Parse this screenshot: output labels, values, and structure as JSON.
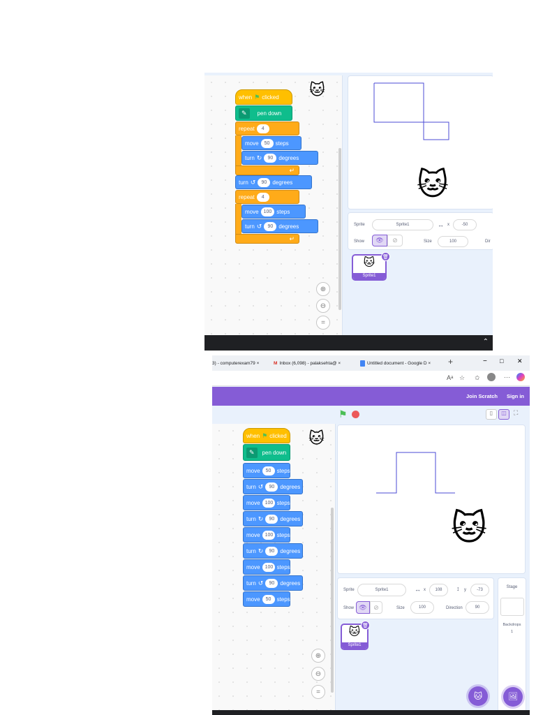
{
  "top": {
    "blocks": {
      "when_clicked": [
        "when",
        "clicked"
      ],
      "pen_down": "pen down",
      "repeat1": {
        "label": "repeat",
        "count": "4"
      },
      "move1": {
        "label": "move",
        "value": "50",
        "unit": "steps"
      },
      "turn_cw": {
        "label": "turn",
        "value": "90",
        "unit": "degrees"
      },
      "turn_ccw": {
        "label": "turn",
        "value": "90",
        "unit": "degrees"
      },
      "repeat2": {
        "label": "repeat",
        "count": "4"
      },
      "move2": {
        "label": "move",
        "value": "100",
        "unit": "steps"
      },
      "turn_ccw2": {
        "label": "turn",
        "value": "90",
        "unit": "degrees"
      }
    },
    "sprite_info": {
      "sprite_label": "Sprite",
      "sprite_name": "Sprite1",
      "x_label": "x",
      "x_value": "-50",
      "show_label": "Show",
      "size_label": "Size",
      "size_value": "100",
      "direction_label_cut": "Dir"
    },
    "sprite_thumb": "Sprite1"
  },
  "bottom": {
    "tabs": [
      {
        "label": "3) - computerexam79 ×"
      },
      {
        "label": "Inbox (6,098) - palaksehta@ ×"
      },
      {
        "label": "Untitled document - Google D ×"
      }
    ],
    "window_controls": [
      "−",
      "□",
      "✕"
    ],
    "header": {
      "join": "Join Scratch",
      "signin": "Sign in"
    },
    "blocks": {
      "when_clicked": [
        "when",
        "clicked"
      ],
      "pen_down": "pen down",
      "list": [
        {
          "label": "move",
          "value": "50",
          "unit": "steps",
          "type": "move"
        },
        {
          "label": "turn",
          "value": "90",
          "unit": "degrees",
          "type": "turn-ccw"
        },
        {
          "label": "move",
          "value": "100",
          "unit": "steps",
          "type": "move"
        },
        {
          "label": "turn",
          "value": "90",
          "unit": "degrees",
          "type": "turn-cw"
        },
        {
          "label": "move",
          "value": "100",
          "unit": "steps",
          "type": "move"
        },
        {
          "label": "turn",
          "value": "90",
          "unit": "degrees",
          "type": "turn-cw"
        },
        {
          "label": "move",
          "value": "100",
          "unit": "steps",
          "type": "move"
        },
        {
          "label": "turn",
          "value": "90",
          "unit": "degrees",
          "type": "turn-ccw"
        },
        {
          "label": "move",
          "value": "50",
          "unit": "steps",
          "type": "move"
        }
      ]
    },
    "sprite_info": {
      "sprite_label": "Sprite",
      "sprite_name": "Sprite1",
      "x_label": "x",
      "x_value": "108",
      "y_label": "y",
      "y_value": "-73",
      "show_label": "Show",
      "size_label": "Size",
      "size_value": "100",
      "direction_label": "Direction",
      "direction_value": "90"
    },
    "sprite_thumb": "Sprite1",
    "stage_panel": {
      "title": "Stage",
      "backdrops_label": "Backdrops",
      "backdrops_count": "1"
    }
  },
  "colors": {
    "scratch_purple": "#855cd6",
    "motion": "#4c97ff",
    "control": "#ffab19",
    "events": "#ffbf00",
    "pen": "#0fbd8c"
  }
}
